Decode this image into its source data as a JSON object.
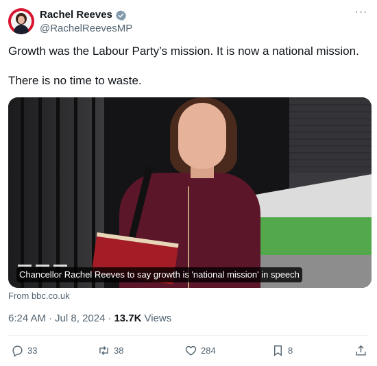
{
  "author": {
    "name": "Rachel Reeves",
    "handle": "@RachelReevesMP",
    "verified_icon": "verified-badge-icon",
    "verified_color": "#829aab"
  },
  "tweet": {
    "line1": "Growth was the Labour Party’s mission. It is now a national mission.",
    "line2": "There is no time to waste."
  },
  "card": {
    "caption": "Chancellor Rachel Reeves to say growth is 'national mission' in speech",
    "source": "From bbc.co.uk"
  },
  "meta": {
    "time": "6:24 AM",
    "sep1": "·",
    "date": "Jul 8, 2024",
    "sep2": "·",
    "views_count": "13.7K",
    "views_label": "Views"
  },
  "actions": {
    "replies": "33",
    "reposts": "38",
    "likes": "284",
    "bookmarks": "8"
  },
  "colors": {
    "text": "#0f1419",
    "secondary": "#536471",
    "divider": "#eff3f4"
  }
}
